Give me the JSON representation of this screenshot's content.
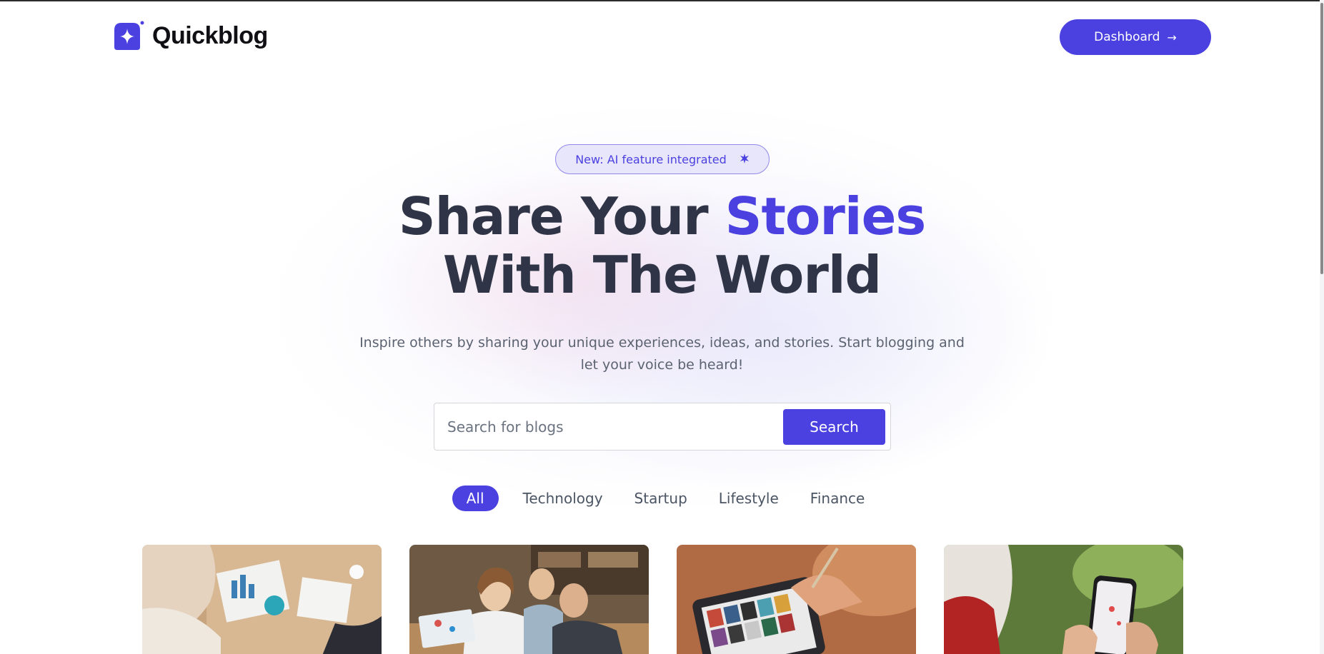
{
  "header": {
    "brand": "Quickblog",
    "dashboard_label": "Dashboard",
    "dashboard_icon": "arrow-right-icon"
  },
  "hero": {
    "badge_text": "New: AI feature integrated",
    "badge_icon": "sparkle-icon",
    "title_part1": "Share Your ",
    "title_accent": "Stories",
    "title_line2": "With The World",
    "subtitle": "Inspire others by sharing your unique experiences, ideas, and stories. Start blogging and let your voice be heard!"
  },
  "search": {
    "placeholder": "Search for blogs",
    "button_label": "Search"
  },
  "categories": [
    {
      "label": "All",
      "active": true
    },
    {
      "label": "Technology",
      "active": false
    },
    {
      "label": "Startup",
      "active": false
    },
    {
      "label": "Lifestyle",
      "active": false
    },
    {
      "label": "Finance",
      "active": false
    }
  ],
  "colors": {
    "accent": "#4b40e0",
    "heading": "#2f3546",
    "body_text": "#5b6270"
  },
  "cards": [
    {
      "image": "business-meeting-charts-photo"
    },
    {
      "image": "students-studying-laptop-photo"
    },
    {
      "image": "tablet-design-gallery-photo"
    },
    {
      "image": "smartphone-map-outdoors-photo"
    }
  ]
}
